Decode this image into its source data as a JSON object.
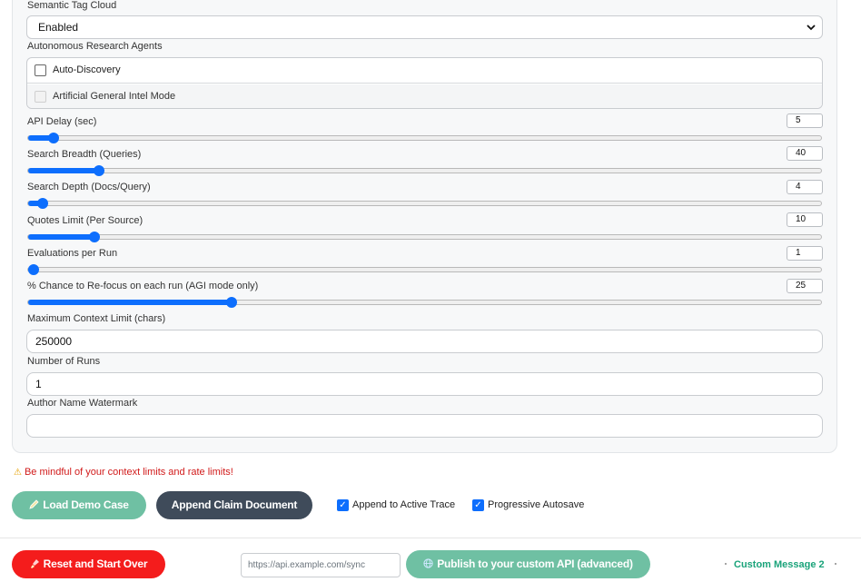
{
  "semantic_tag_cloud": {
    "label": "Semantic Tag Cloud",
    "value": "Enabled"
  },
  "agents": {
    "label": "Autonomous Research Agents",
    "options": [
      {
        "label": "Auto-Discovery",
        "checked": false,
        "disabled": false
      },
      {
        "label": "Artificial General Intel Mode",
        "checked": false,
        "disabled": true
      }
    ]
  },
  "sliders": [
    {
      "label": "API Delay (sec)",
      "value": "5",
      "fraction": 0.025
    },
    {
      "label": "Search Breadth (Queries)",
      "value": "40",
      "fraction": 0.084
    },
    {
      "label": "Search Depth (Docs/Query)",
      "value": "4",
      "fraction": 0.012
    },
    {
      "label": "Quotes Limit (Per Source)",
      "value": "10",
      "fraction": 0.078
    },
    {
      "label": "Evaluations per Run",
      "value": "1",
      "fraction": 0.0
    },
    {
      "label": "% Chance to Re-focus on each run (AGI mode only)",
      "value": "25",
      "fraction": 0.253
    }
  ],
  "fields": {
    "max_context": {
      "label": "Maximum Context Limit (chars)",
      "value": "250000"
    },
    "num_runs": {
      "label": "Number of Runs",
      "value": "1"
    },
    "author": {
      "label": "Author Name Watermark",
      "value": ""
    }
  },
  "warning": "Be mindful of your context limits and rate limits!",
  "buttons": {
    "load_demo": "Load Demo Case",
    "append_claim": "Append Claim Document",
    "reset": "Reset and Start Over",
    "publish": "Publish to your custom API (advanced)"
  },
  "toggles": {
    "append_trace": {
      "label": "Append to Active Trace",
      "checked": true
    },
    "autosave": {
      "label": "Progressive Autosave",
      "checked": true
    }
  },
  "api_url_placeholder": "https://api.example.com/sync",
  "custom_message": "Custom Message 2",
  "colors": {
    "accent": "#0d6efd",
    "green": "#6fc0a3",
    "dark": "#3f4b5a",
    "danger": "#f41c1c"
  },
  "icons": {
    "select_caret": "chevron-down-icon",
    "warning": "warning-icon",
    "demo": "pencil-icon",
    "reset": "brush-icon",
    "publish": "globe-icon"
  }
}
